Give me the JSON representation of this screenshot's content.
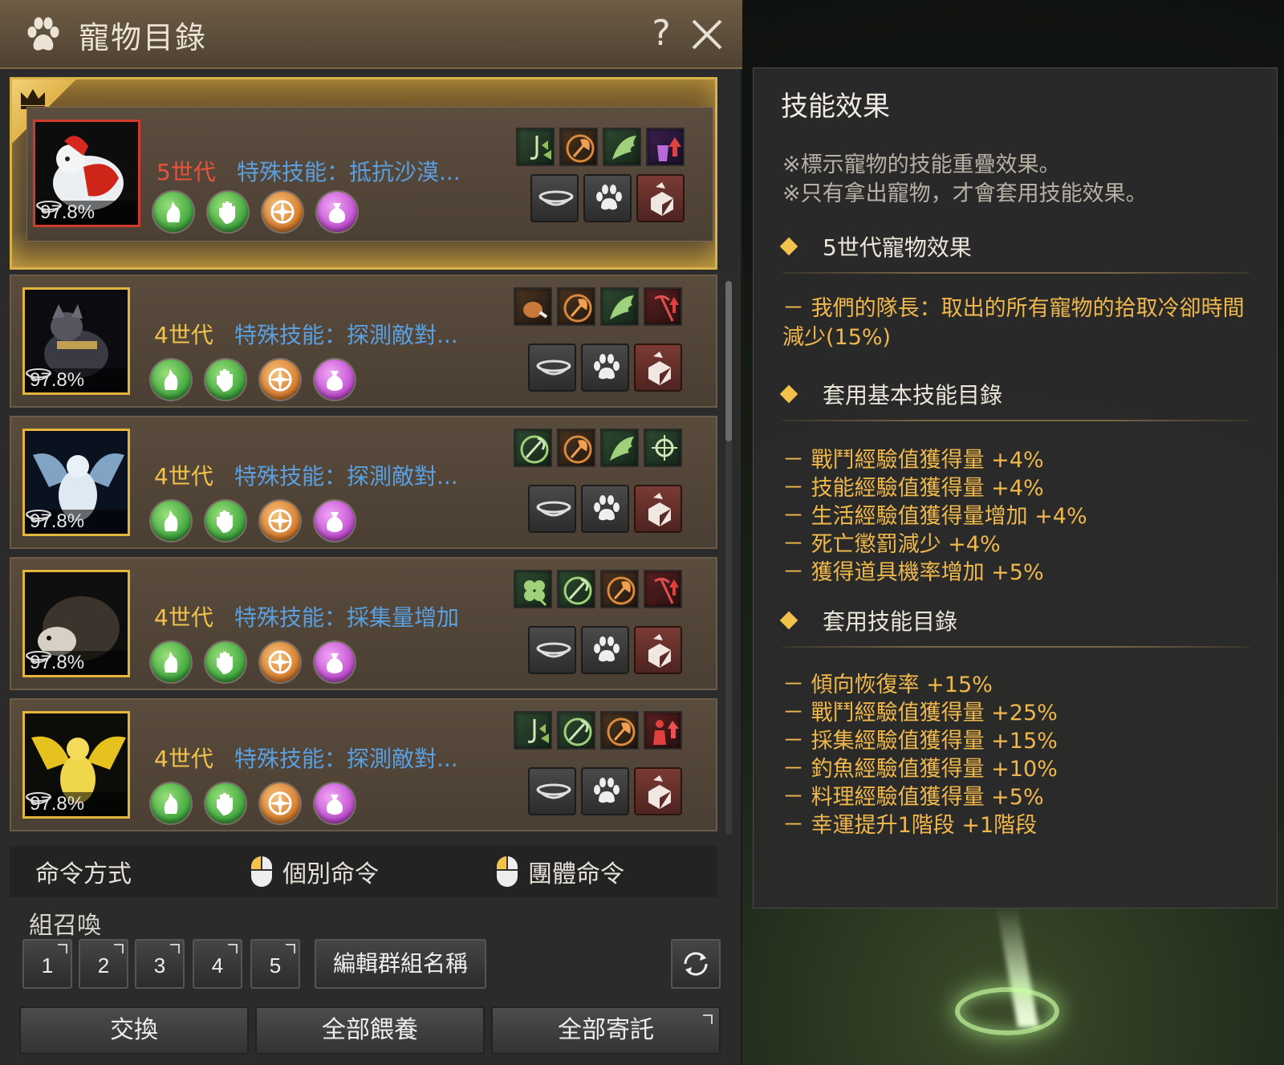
{
  "window": {
    "title": "寵物目錄",
    "help_label": "?",
    "paw_icon": "paw-icon",
    "close_icon": "close-icon"
  },
  "pets": [
    {
      "generation": "5世代",
      "special_skill": "特殊技能：抵抗沙漠...",
      "hunger_pct": "97.8%",
      "featured": true,
      "accent_color": "#cf3b2e",
      "skill_icons": [
        "fishing-icon",
        "axe-icon",
        "wing-icon",
        "bag-up-icon"
      ]
    },
    {
      "generation": "4世代",
      "special_skill": "特殊技能：探測敵對...",
      "hunger_pct": "97.8%",
      "featured": false,
      "skill_icons": [
        "meat-icon",
        "axe-icon",
        "wing-icon",
        "pickaxe-up-icon"
      ]
    },
    {
      "generation": "4世代",
      "special_skill": "特殊技能：探測敵對...",
      "hunger_pct": "97.8%",
      "featured": false,
      "skill_icons": [
        "gather-icon",
        "axe-icon",
        "wing-icon",
        "target-icon"
      ]
    },
    {
      "generation": "4世代",
      "special_skill": "特殊技能：採集量增加",
      "hunger_pct": "97.8%",
      "featured": false,
      "skill_icons": [
        "clover-icon",
        "gather-icon",
        "axe-icon",
        "pickaxe-up-icon"
      ]
    },
    {
      "generation": "4世代",
      "special_skill": "特殊技能：探測敵對...",
      "hunger_pct": "97.8%",
      "featured": false,
      "skill_icons": [
        "fishing-icon",
        "gather-icon",
        "axe-icon",
        "person-up-icon"
      ]
    }
  ],
  "command": {
    "label": "命令方式",
    "individual": "個別命令",
    "group": "團體命令"
  },
  "summon": {
    "label": "組召喚",
    "slots": [
      "1",
      "2",
      "3",
      "4",
      "5"
    ],
    "edit_group": "編輯群組名稱"
  },
  "bottom_buttons": {
    "exchange": "交換",
    "feed_all": "全部餵養",
    "deposit_all": "全部寄託"
  },
  "effects": {
    "title": "技能效果",
    "notes": [
      "※標示寵物的技能重疊效果。",
      "※只有拿出寵物，才會套用技能效果。"
    ],
    "sections": [
      {
        "header": "5世代寵物效果",
        "lines": [
          "－ 我們的隊長：取出的所有寵物的拾取冷卻時間減少(15%)"
        ]
      },
      {
        "header": "套用基本技能目錄",
        "lines": [
          "－ 戰鬥經驗值獲得量 +4%",
          "－ 技能經驗值獲得量 +4%",
          "－ 生活經驗值獲得量增加 +4%",
          "－ 死亡懲罰減少 +4%",
          "－ 獲得道具機率增加 +5%"
        ]
      },
      {
        "header": "套用技能目錄",
        "lines": [
          "－ 傾向恢復率 +15%",
          "－ 戰鬥經驗值獲得量 +25%",
          "－ 採集經驗值獲得量 +15%",
          "－ 釣魚經驗值獲得量 +10%",
          "－ 料理經驗值獲得量 +5%",
          "－ 幸運提升1階段 +1階段"
        ]
      }
    ]
  },
  "colors": {
    "gold_accent": "#f2c24a",
    "skill_blue": "#5a9fe0",
    "effect_text": "#f0b84a"
  }
}
